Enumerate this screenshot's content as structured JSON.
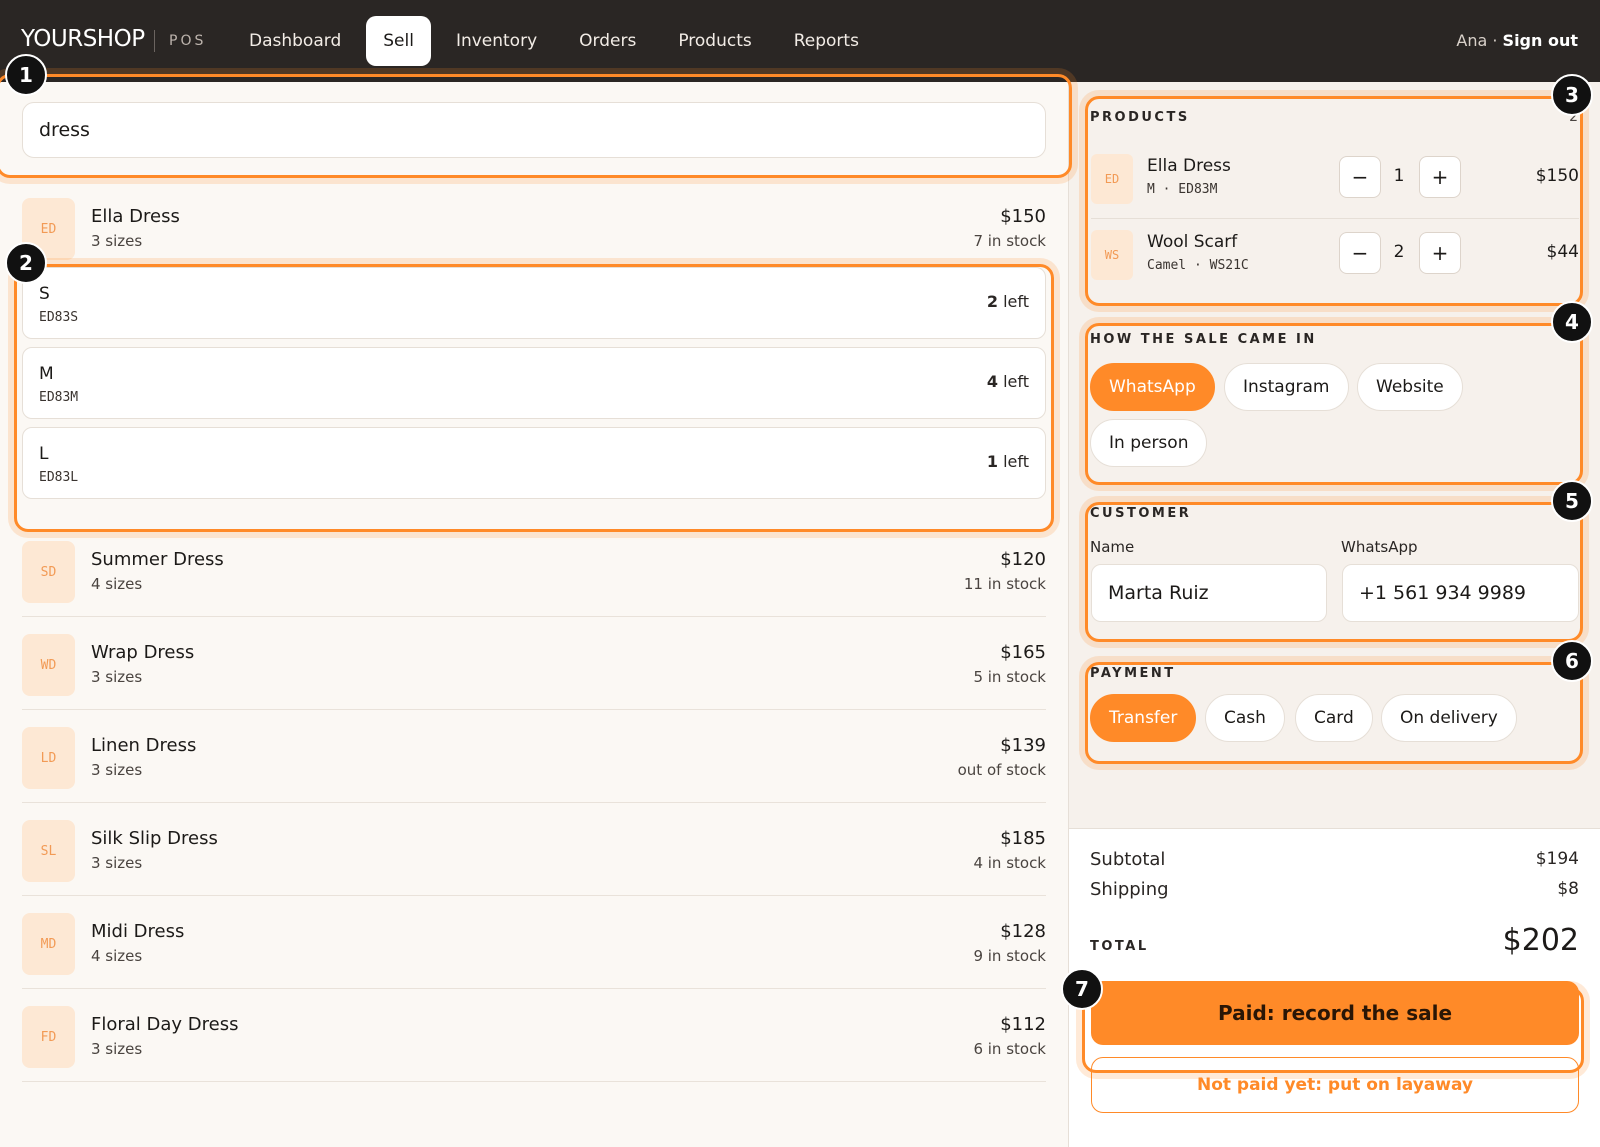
{
  "header": {
    "brand": "YOURSHOP",
    "brand_sub": "POS",
    "nav": [
      "Dashboard",
      "Sell",
      "Inventory",
      "Orders",
      "Products",
      "Reports"
    ],
    "active_nav": "Sell",
    "user": "Ana ·",
    "sign_out": "Sign out"
  },
  "search": {
    "value": "dress"
  },
  "expanded_product": {
    "initials": "ED",
    "name": "Ella Dress",
    "sizes": "3 sizes",
    "price": "$150",
    "stock": "7 in stock",
    "variants": [
      {
        "size": "S",
        "sku": "ED83S",
        "count": "2",
        "suffix": " left"
      },
      {
        "size": "M",
        "sku": "ED83M",
        "count": "4",
        "suffix": " left"
      },
      {
        "size": "L",
        "sku": "ED83L",
        "count": "1",
        "suffix": " left"
      }
    ]
  },
  "products": [
    {
      "initials": "SD",
      "name": "Summer Dress",
      "sizes": "4 sizes",
      "price": "$120",
      "stock": "11 in stock"
    },
    {
      "initials": "WD",
      "name": "Wrap Dress",
      "sizes": "3 sizes",
      "price": "$165",
      "stock": "5 in stock"
    },
    {
      "initials": "LD",
      "name": "Linen Dress",
      "sizes": "3 sizes",
      "price": "$139",
      "stock": "out of stock"
    },
    {
      "initials": "SL",
      "name": "Silk Slip Dress",
      "sizes": "3 sizes",
      "price": "$185",
      "stock": "4 in stock"
    },
    {
      "initials": "MD",
      "name": "Midi Dress",
      "sizes": "4 sizes",
      "price": "$128",
      "stock": "9 in stock"
    },
    {
      "initials": "FD",
      "name": "Floral Day Dress",
      "sizes": "3 sizes",
      "price": "$112",
      "stock": "6 in stock"
    }
  ],
  "cart": {
    "title": "PRODUCTS",
    "count": "2",
    "items": [
      {
        "initials": "ED",
        "name": "Ella Dress",
        "meta": "M · ED83M",
        "qty": "1",
        "price": "$150"
      },
      {
        "initials": "WS",
        "name": "Wool Scarf",
        "meta": "Camel · WS21C",
        "qty": "2",
        "price": "$44"
      }
    ],
    "minus": "−",
    "plus": "+"
  },
  "channel": {
    "title": "HOW THE SALE CAME IN",
    "options": [
      "WhatsApp",
      "Instagram",
      "Website",
      "In person"
    ],
    "selected": "WhatsApp"
  },
  "customer": {
    "title": "CUSTOMER",
    "name_label": "Name",
    "name_value": "Marta Ruiz",
    "phone_label": "WhatsApp",
    "phone_value": "+1 561 934 9989"
  },
  "payment": {
    "title": "PAYMENT",
    "options": [
      "Transfer",
      "Cash",
      "Card",
      "On delivery"
    ],
    "selected": "Transfer"
  },
  "totals": {
    "subtotal_label": "Subtotal",
    "subtotal": "$194",
    "shipping_label": "Shipping",
    "shipping": "$8",
    "total_label": "TOTAL",
    "total": "$202"
  },
  "actions": {
    "primary": "Paid: record the sale",
    "secondary": "Not paid yet: put on layaway"
  },
  "annotations": [
    "1",
    "2",
    "3",
    "4",
    "5",
    "6",
    "7"
  ],
  "colors": {
    "accent": "#ff8a28",
    "topbar": "#2a2624",
    "thumb_bg": "#fde8d4"
  }
}
